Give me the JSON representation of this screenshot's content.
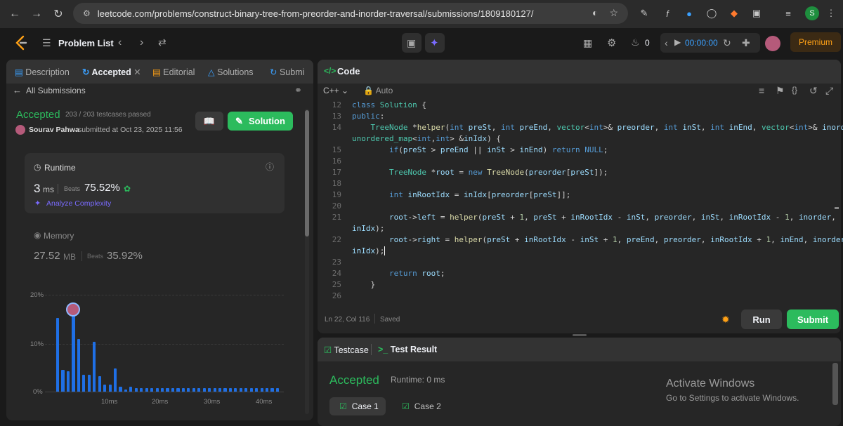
{
  "browser": {
    "url": "leetcode.com/problems/construct-binary-tree-from-preorder-and-inorder-traversal/submissions/1809180127/",
    "profile_initial": "S"
  },
  "topnav": {
    "problem_list": "Problem List",
    "streak_count": "0",
    "timer": "00:00:00",
    "premium": "Premium"
  },
  "left": {
    "tabs": [
      "Description",
      "Accepted",
      "Editorial",
      "Solutions",
      "Submi"
    ],
    "all_submissions": "All Submissions",
    "status": "Accepted",
    "testcases": "203 / 203 testcases passed",
    "author": "Sourav Pahwa",
    "submitted_at": "submitted at Oct 23, 2025 11:56",
    "solution_btn": "Solution",
    "runtime": {
      "label": "Runtime",
      "value": "3",
      "unit": "ms",
      "beats_label": "Beats",
      "beats": "75.52%",
      "analyze": "Analyze Complexity"
    },
    "memory": {
      "label": "Memory",
      "value": "27.52",
      "unit": "MB",
      "beats_label": "Beats",
      "beats": "35.92%"
    },
    "distribution": {
      "y_ticks": [
        "20%",
        "10%",
        "0%"
      ],
      "x_ticks": [
        "10ms",
        "20ms",
        "30ms",
        "40ms"
      ],
      "bars": [
        15.5,
        4.5,
        4.3,
        17.2,
        11.0,
        3.5,
        3.5,
        10.5,
        3.2,
        1.5,
        1.5,
        4.8,
        1.0,
        0.5,
        1.0,
        0.7,
        0.7,
        0.7,
        0.7,
        0.7,
        0.7,
        0.7,
        0.7,
        0.7,
        0.7,
        0.7,
        0.7,
        0.7,
        0.7,
        0.7,
        0.7,
        0.7,
        0.7,
        0.7,
        0.7,
        0.7,
        0.7,
        0.7,
        0.7,
        0.7,
        0.7,
        0.7,
        0.7
      ]
    }
  },
  "code": {
    "title": "Code",
    "language": "C++",
    "auto": "Auto",
    "status_bar": "Ln 22, Col 116",
    "saved": "Saved",
    "run": "Run",
    "submit": "Submit"
  },
  "bottom": {
    "testcase_tab": "Testcase",
    "result_tab": "Test Result",
    "status": "Accepted",
    "runtime": "Runtime: 0 ms",
    "cases": [
      "Case 1",
      "Case 2"
    ],
    "activate_title": "Activate Windows",
    "activate_sub": "Go to Settings to activate Windows."
  }
}
